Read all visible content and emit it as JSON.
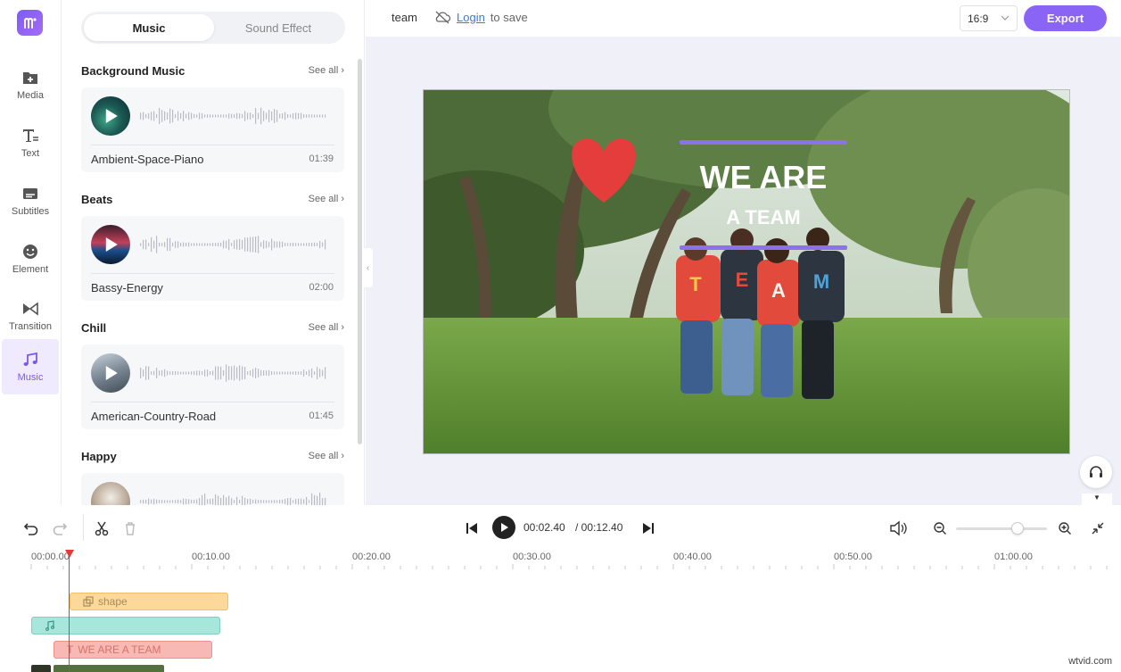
{
  "rail": {
    "items": [
      {
        "label": "Media",
        "icon": "media-add-icon"
      },
      {
        "label": "Text",
        "icon": "text-icon"
      },
      {
        "label": "Subtitles",
        "icon": "subtitles-icon"
      },
      {
        "label": "Element",
        "icon": "element-icon"
      },
      {
        "label": "Transition",
        "icon": "transition-icon"
      },
      {
        "label": "Music",
        "icon": "music-note-icon"
      }
    ],
    "active": "Music",
    "accent": "#7b57f2"
  },
  "panel": {
    "tabs": [
      "Music",
      "Sound Effect"
    ],
    "active_tab": "Music",
    "see_all": "See all",
    "sections": [
      {
        "title": "Background Music",
        "track": "Ambient-Space-Piano",
        "duration": "01:39"
      },
      {
        "title": "Beats",
        "track": "Bassy-Energy",
        "duration": "02:00"
      },
      {
        "title": "Chill",
        "track": "American-Country-Road",
        "duration": "01:45"
      },
      {
        "title": "Happy",
        "track": "",
        "duration": ""
      }
    ]
  },
  "topbar": {
    "project_name": "team",
    "login_link": "Login",
    "save_suffix": "to save",
    "ratio": "16:9",
    "export_label": "Export",
    "export_color": "#8a64f5"
  },
  "preview": {
    "headline_1": "WE ARE",
    "headline_2": "A TEAM",
    "shirt_letters": [
      "T",
      "E",
      "A",
      "M"
    ]
  },
  "controls": {
    "current_time": "00:02.40",
    "total_time": "/ 00:12.40",
    "zoom_level": 0.68
  },
  "timeline": {
    "ruler_labels": [
      "00:00.00",
      "00:10.00",
      "00:20.00",
      "00:30.00",
      "00:40.00",
      "00:50.00",
      "01:00.00"
    ],
    "clips": {
      "shape_label": "shape",
      "text_label": "WE ARE A TEAM"
    }
  },
  "watermark": "wtvid.com"
}
